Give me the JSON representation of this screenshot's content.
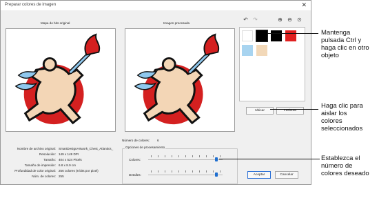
{
  "dialog": {
    "title": "Preparar colores de imagen",
    "close_glyph": "✕"
  },
  "panels": {
    "original_label": "Mapa de bits original",
    "processed_label": "Imagen procesada"
  },
  "toolbar": {
    "undo": "undo-icon",
    "redo": "redo-icon",
    "zoom_in": "zoom-in-icon",
    "zoom_out": "zoom-out-icon",
    "zoom_fit": "zoom-fit-icon"
  },
  "swatches": {
    "colors": [
      "#ffffff",
      "#000000",
      "#000000",
      "#e02020",
      "#a8d4f0",
      "#f2d8b8"
    ]
  },
  "buttons": {
    "ubicar": "Ubicar",
    "fusionar": "Fusionar",
    "aceptar": "Aceptar",
    "cancelar": "Cancelar"
  },
  "info": {
    "num_colores_label": "Número de colores:",
    "num_colores_value": "6",
    "rows": [
      {
        "label": "Nombre de archivo original:",
        "value": "SmartDesignArtwork_Chest_Atlantics_"
      },
      {
        "label": "Resolución:",
        "value": "149 x 149 DPI"
      },
      {
        "label": "Tamaño:",
        "value": "404 x 524 Pixels"
      },
      {
        "label": "Tamaño de impresión:",
        "value": "6.8 x 8.9 cm"
      },
      {
        "label": "Profundidad de color original:",
        "value": "256 colores (8 bits por pixel)"
      },
      {
        "label": "Núm. de colores:",
        "value": "255"
      }
    ]
  },
  "processing": {
    "group_title": "Opciones de procesamiento",
    "colores_label": "Colores:",
    "detalles_label": "Detalles:",
    "colores_level": 0.92,
    "detalles_level": 0.92
  },
  "annotations": {
    "ctrl_click": "Mantenga\npulsada Ctrl y\nhaga clic en otro\nobjeto",
    "isolate": "Haga clic para\naislar los\ncolores\nseleccionados",
    "set_number": "Establezca el\nnúmero de\ncolores deseado"
  },
  "colors": {
    "accent": "#2a6fd6",
    "red_disc": "#d42020",
    "skin": "#f3d6b6",
    "flame_blue": "#8fc8ee"
  }
}
